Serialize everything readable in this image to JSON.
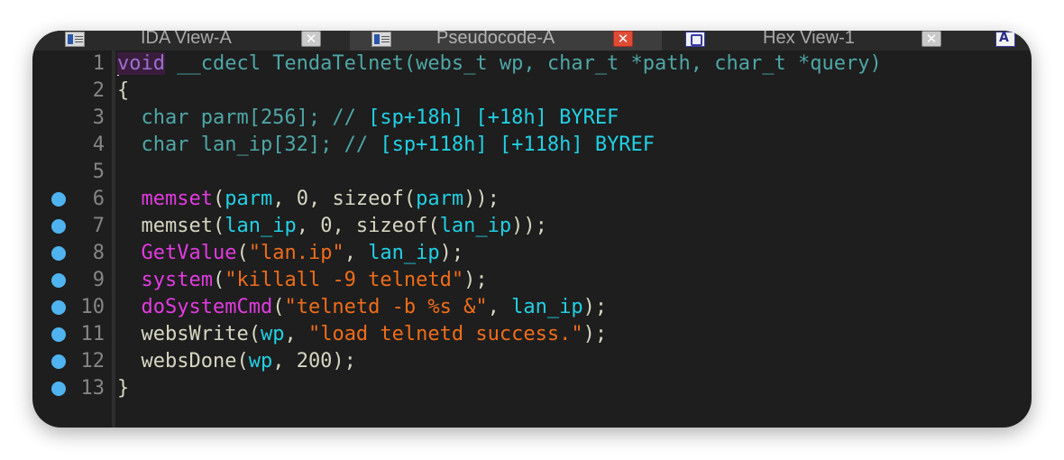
{
  "tabs": [
    {
      "label": "IDA View-A",
      "active": false,
      "icon": "listing-icon"
    },
    {
      "label": "Pseudocode-A",
      "active": true,
      "icon": "listing-icon"
    },
    {
      "label": "Hex View-1",
      "active": false,
      "icon": "hex-icon"
    },
    {
      "label": "",
      "active": false,
      "icon": "structures-icon",
      "glyph": "A"
    }
  ],
  "close_glyph": "✕",
  "colors": {
    "background": "#1e1e1e",
    "function_call": "#e23be0",
    "variable": "#21d0e4",
    "string": "#ef6d1a",
    "breakpoint": "#4fb3ef"
  },
  "code_lines": [
    {
      "n": "1",
      "bp": false,
      "tokens": [
        {
          "t": "void",
          "c": "kw-hl"
        },
        {
          "t": " __cdecl TendaTelnet(webs_t wp, char_t *path, char_t *query)",
          "c": "teal"
        }
      ]
    },
    {
      "n": "2",
      "bp": false,
      "tokens": [
        {
          "t": "{",
          "c": "plain"
        }
      ]
    },
    {
      "n": "3",
      "bp": false,
      "tokens": [
        {
          "t": "  char parm[256]; // ",
          "c": "teal"
        },
        {
          "t": "[sp+18h] [+18h] BYREF",
          "c": "cyan"
        }
      ]
    },
    {
      "n": "4",
      "bp": false,
      "tokens": [
        {
          "t": "  char lan_ip[32]; // ",
          "c": "teal"
        },
        {
          "t": "[sp+118h] [+118h] BYREF",
          "c": "cyan"
        }
      ]
    },
    {
      "n": "5",
      "bp": false,
      "tokens": []
    },
    {
      "n": "6",
      "bp": true,
      "tokens": [
        {
          "t": "  ",
          "c": "plain"
        },
        {
          "t": "memset",
          "c": "magenta"
        },
        {
          "t": "(",
          "c": "plain"
        },
        {
          "t": "parm",
          "c": "cyan"
        },
        {
          "t": ", 0, sizeof(",
          "c": "plain"
        },
        {
          "t": "parm",
          "c": "cyan"
        },
        {
          "t": "));",
          "c": "plain"
        }
      ]
    },
    {
      "n": "7",
      "bp": true,
      "tokens": [
        {
          "t": "  memset(",
          "c": "plain"
        },
        {
          "t": "lan_ip",
          "c": "cyan"
        },
        {
          "t": ", 0, sizeof(",
          "c": "plain"
        },
        {
          "t": "lan_ip",
          "c": "cyan"
        },
        {
          "t": "));",
          "c": "plain"
        }
      ]
    },
    {
      "n": "8",
      "bp": true,
      "tokens": [
        {
          "t": "  ",
          "c": "plain"
        },
        {
          "t": "GetValue",
          "c": "magenta"
        },
        {
          "t": "(",
          "c": "plain"
        },
        {
          "t": "\"lan.ip\"",
          "c": "str"
        },
        {
          "t": ", ",
          "c": "plain"
        },
        {
          "t": "lan_ip",
          "c": "cyan"
        },
        {
          "t": ");",
          "c": "plain"
        }
      ]
    },
    {
      "n": "9",
      "bp": true,
      "tokens": [
        {
          "t": "  ",
          "c": "plain"
        },
        {
          "t": "system",
          "c": "magenta"
        },
        {
          "t": "(",
          "c": "plain"
        },
        {
          "t": "\"killall -9 telnetd\"",
          "c": "str"
        },
        {
          "t": ");",
          "c": "plain"
        }
      ]
    },
    {
      "n": "10",
      "bp": true,
      "tokens": [
        {
          "t": "  ",
          "c": "plain"
        },
        {
          "t": "doSystemCmd",
          "c": "magenta"
        },
        {
          "t": "(",
          "c": "plain"
        },
        {
          "t": "\"telnetd -b %s &\"",
          "c": "str"
        },
        {
          "t": ", ",
          "c": "plain"
        },
        {
          "t": "lan_ip",
          "c": "cyan"
        },
        {
          "t": ");",
          "c": "plain"
        }
      ]
    },
    {
      "n": "11",
      "bp": true,
      "tokens": [
        {
          "t": "  websWrite(",
          "c": "plain"
        },
        {
          "t": "wp",
          "c": "cyan"
        },
        {
          "t": ", ",
          "c": "plain"
        },
        {
          "t": "\"load telnetd success.\"",
          "c": "str"
        },
        {
          "t": ");",
          "c": "plain"
        }
      ]
    },
    {
      "n": "12",
      "bp": true,
      "tokens": [
        {
          "t": "  websDone(",
          "c": "plain"
        },
        {
          "t": "wp",
          "c": "cyan"
        },
        {
          "t": ", 200);",
          "c": "plain"
        }
      ]
    },
    {
      "n": "13",
      "bp": true,
      "tokens": [
        {
          "t": "}",
          "c": "plain"
        }
      ]
    }
  ]
}
